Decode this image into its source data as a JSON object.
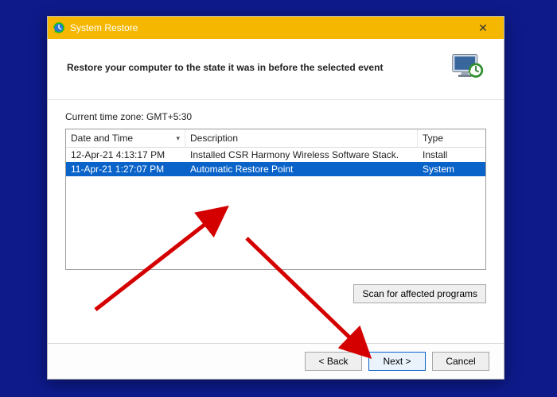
{
  "title": "System Restore",
  "header": "Restore your computer to the state it was in before the selected event",
  "timezone_label": "Current time zone: GMT+5:30",
  "columns": {
    "dt": "Date and Time",
    "desc": "Description",
    "type": "Type"
  },
  "rows": [
    {
      "dt": "12-Apr-21 4:13:17 PM",
      "desc": "Installed CSR Harmony Wireless Software Stack.",
      "type": "Install"
    },
    {
      "dt": "11-Apr-21 1:27:07 PM",
      "desc": "Automatic Restore Point",
      "type": "System"
    }
  ],
  "buttons": {
    "scan": "Scan for affected programs",
    "back": "< Back",
    "next": "Next >",
    "cancel": "Cancel"
  }
}
